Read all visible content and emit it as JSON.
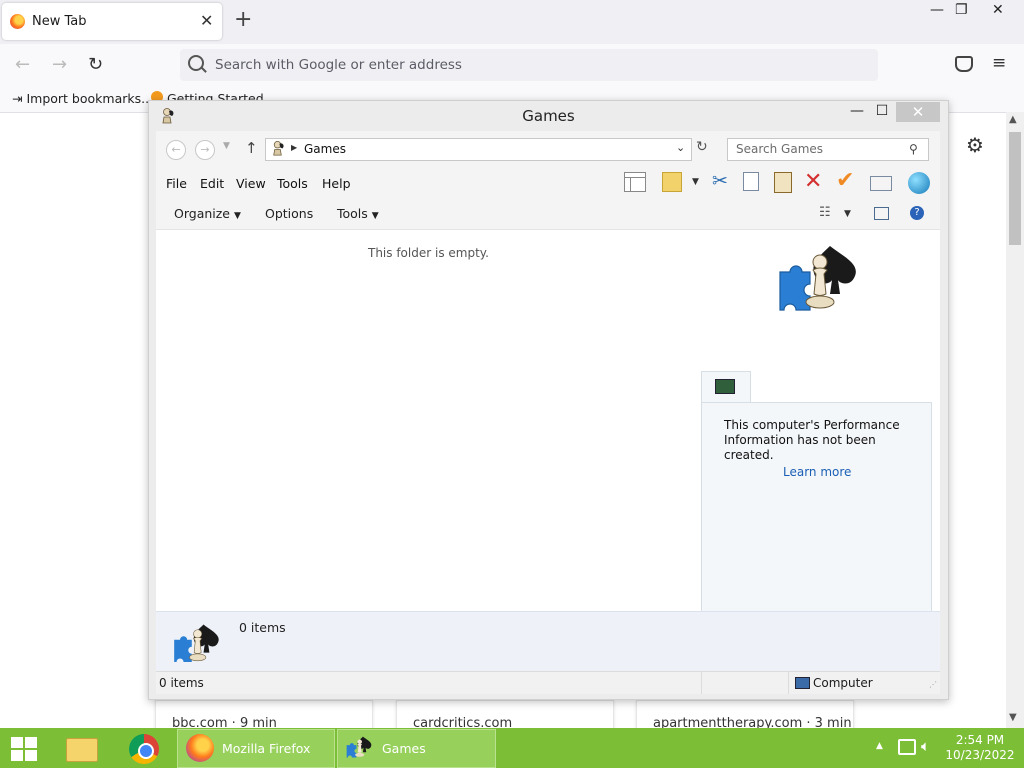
{
  "browser": {
    "tab_title": "New Tab",
    "address_placeholder": "Search with Google or enter address",
    "bookmarks": [
      "Import bookmarks...",
      "Getting Started"
    ],
    "tiles": [
      "bbc.com · 9 min",
      "cardcritics.com",
      "apartmenttherapy.com · 3 min"
    ]
  },
  "explorer": {
    "title": "Games",
    "breadcrumb": "Games",
    "search_placeholder": "Search Games",
    "menu": [
      "File",
      "Edit",
      "View",
      "Tools",
      "Help"
    ],
    "commands": [
      "Organize",
      "Options",
      "Tools"
    ],
    "empty_message": "This folder is empty.",
    "performance_text": "This computer's Performance Information has not been created.",
    "learn_more": "Learn more",
    "details_count": "0 items",
    "status_left": "0 items",
    "status_right": "Computer"
  },
  "taskbar": {
    "apps": [
      "Mozilla Firefox",
      "Games"
    ],
    "time": "2:54 PM",
    "date": "10/23/2022"
  }
}
